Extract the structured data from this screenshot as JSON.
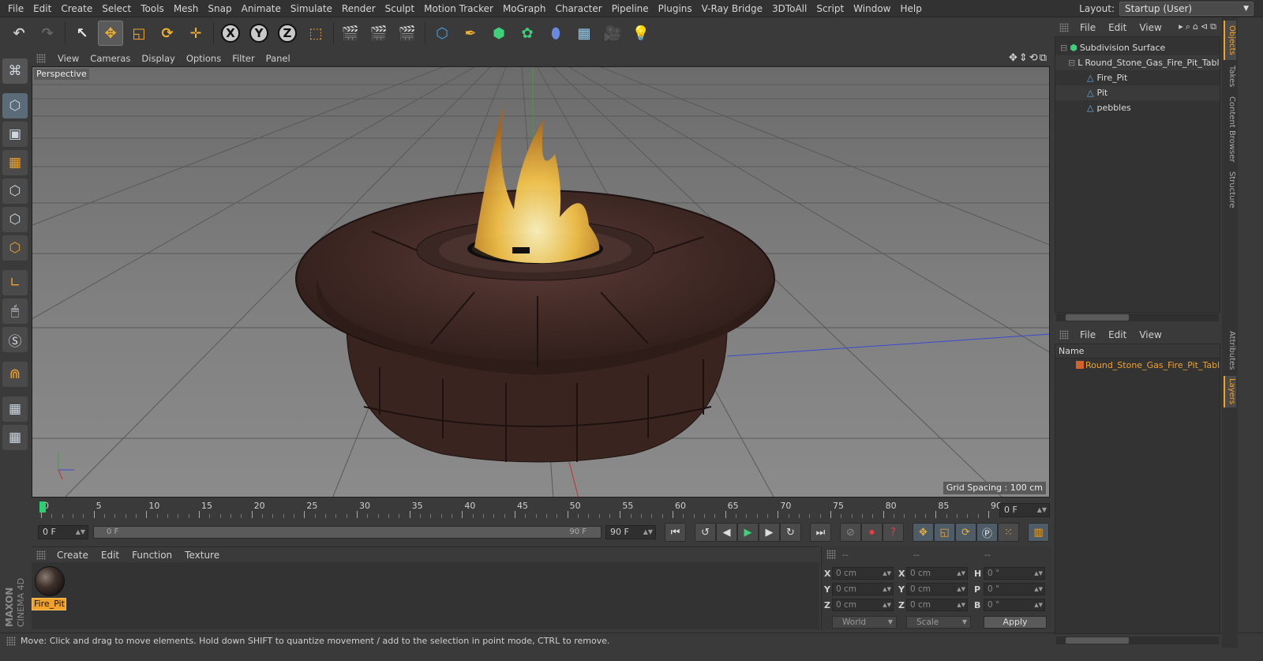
{
  "menubar": {
    "items": [
      "File",
      "Edit",
      "Create",
      "Select",
      "Tools",
      "Mesh",
      "Snap",
      "Animate",
      "Simulate",
      "Render",
      "Sculpt",
      "Motion Tracker",
      "MoGraph",
      "Character",
      "Pipeline",
      "Plugins",
      "V-Ray Bridge",
      "3DToAll",
      "Script",
      "Window",
      "Help"
    ],
    "layout_label": "Layout:",
    "layout_value": "Startup (User)"
  },
  "toolbar": {
    "axis_x": "X",
    "axis_y": "Y",
    "axis_z": "Z"
  },
  "viewport": {
    "menus": [
      "View",
      "Cameras",
      "Display",
      "Options",
      "Filter",
      "Panel"
    ],
    "label": "Perspective",
    "grid_spacing": "Grid Spacing : 100 cm"
  },
  "timeline": {
    "ticks": [
      "0",
      "5",
      "10",
      "15",
      "20",
      "25",
      "30",
      "35",
      "40",
      "45",
      "50",
      "55",
      "60",
      "65",
      "70",
      "75",
      "80",
      "85",
      "90"
    ],
    "current_frame_right": "0 F",
    "start_frame": "0 F",
    "range_start": "0 F",
    "range_end": "90 F",
    "end_frame": "90 F"
  },
  "material_manager": {
    "menus": [
      "Create",
      "Edit",
      "Function",
      "Texture"
    ],
    "material_name": "Fire_Pit"
  },
  "coordinates": {
    "header": [
      "--",
      "--",
      "--"
    ],
    "rows": [
      {
        "l1": "X",
        "v1": "0 cm",
        "l2": "X",
        "v2": "0 cm",
        "l3": "H",
        "v3": "0 °"
      },
      {
        "l1": "Y",
        "v1": "0 cm",
        "l2": "Y",
        "v2": "0 cm",
        "l3": "P",
        "v3": "0 °"
      },
      {
        "l1": "Z",
        "v1": "0 cm",
        "l2": "Z",
        "v2": "0 cm",
        "l3": "B",
        "v3": "0 °"
      }
    ],
    "mode": "World",
    "type": "Scale",
    "apply": "Apply"
  },
  "status": {
    "text": "Move: Click and drag to move elements. Hold down SHIFT to quantize movement / add to the selection in point mode, CTRL to remove."
  },
  "object_manager": {
    "menus": [
      "File",
      "Edit",
      "View"
    ],
    "items": [
      "Subdivision Surface",
      "Round_Stone_Gas_Fire_Pit_Table",
      "Fire_Pit",
      "Pit",
      "pebbles"
    ]
  },
  "layer_manager": {
    "menus": [
      "File",
      "Edit",
      "View"
    ],
    "column": "Name",
    "layer_name": "Round_Stone_Gas_Fire_Pit_Table_"
  },
  "side_tabs": [
    "Objects",
    "Takes",
    "Content Browser",
    "Structure",
    "Attributes",
    "Layers"
  ],
  "brand": {
    "line1": "MAXON",
    "line2": "CINEMA 4D"
  }
}
